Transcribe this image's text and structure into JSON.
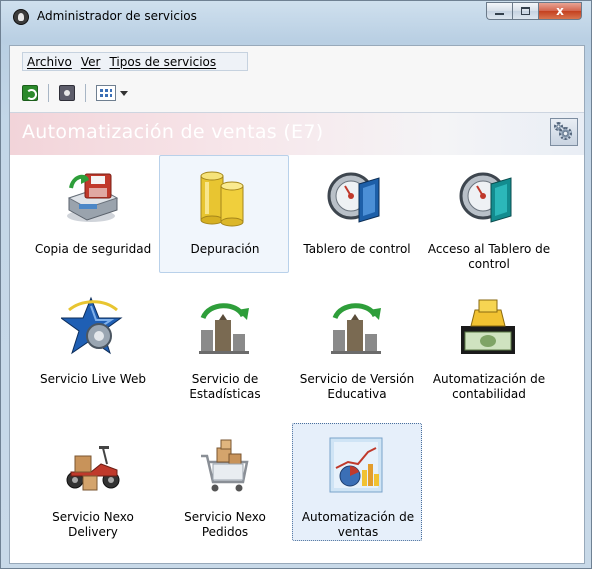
{
  "window": {
    "title": "Administrador de servicios",
    "close_glyph": "x"
  },
  "menu": [
    {
      "label": "Archivo"
    },
    {
      "label": "Ver"
    },
    {
      "label": "Tipos de servicios"
    }
  ],
  "toolbar": {
    "icons": [
      "refresh-icon",
      "stop-service-icon",
      "view-mode-icon",
      "dropdown-arrow-icon"
    ]
  },
  "header": {
    "title": "Automatización de ventas (E7)",
    "settings_icon": "gears-icon"
  },
  "services": [
    {
      "label": "Copia de seguridad",
      "icon": "backup-disk-icon",
      "state": "normal"
    },
    {
      "label": "Depuración",
      "icon": "database-cleanup-icon",
      "state": "hover"
    },
    {
      "label": "Tablero de control",
      "icon": "control-board-icon",
      "state": "normal"
    },
    {
      "label": "Acceso al Tablero de control",
      "icon": "board-access-icon",
      "state": "normal"
    },
    {
      "label": "Servicio Live Web",
      "icon": "live-web-star-icon",
      "state": "normal"
    },
    {
      "label": "Servicio de Estadísticas",
      "icon": "statistics-sync-icon",
      "state": "normal"
    },
    {
      "label": "Servicio de Versión Educativa",
      "icon": "educational-sync-icon",
      "state": "normal"
    },
    {
      "label": "Automatización de contabilidad",
      "icon": "accounting-money-icon",
      "state": "normal"
    },
    {
      "label": "Servicio Nexo Delivery",
      "icon": "delivery-scooter-icon",
      "state": "normal"
    },
    {
      "label": "Servicio Nexo Pedidos",
      "icon": "orders-cart-icon",
      "state": "normal"
    },
    {
      "label": "Automatización de ventas",
      "icon": "sales-chart-icon",
      "state": "selected"
    }
  ],
  "colors": {
    "selection_border": "#4a6f9c",
    "selection_fill": "#e6effa",
    "header_text": "#ffffff"
  }
}
